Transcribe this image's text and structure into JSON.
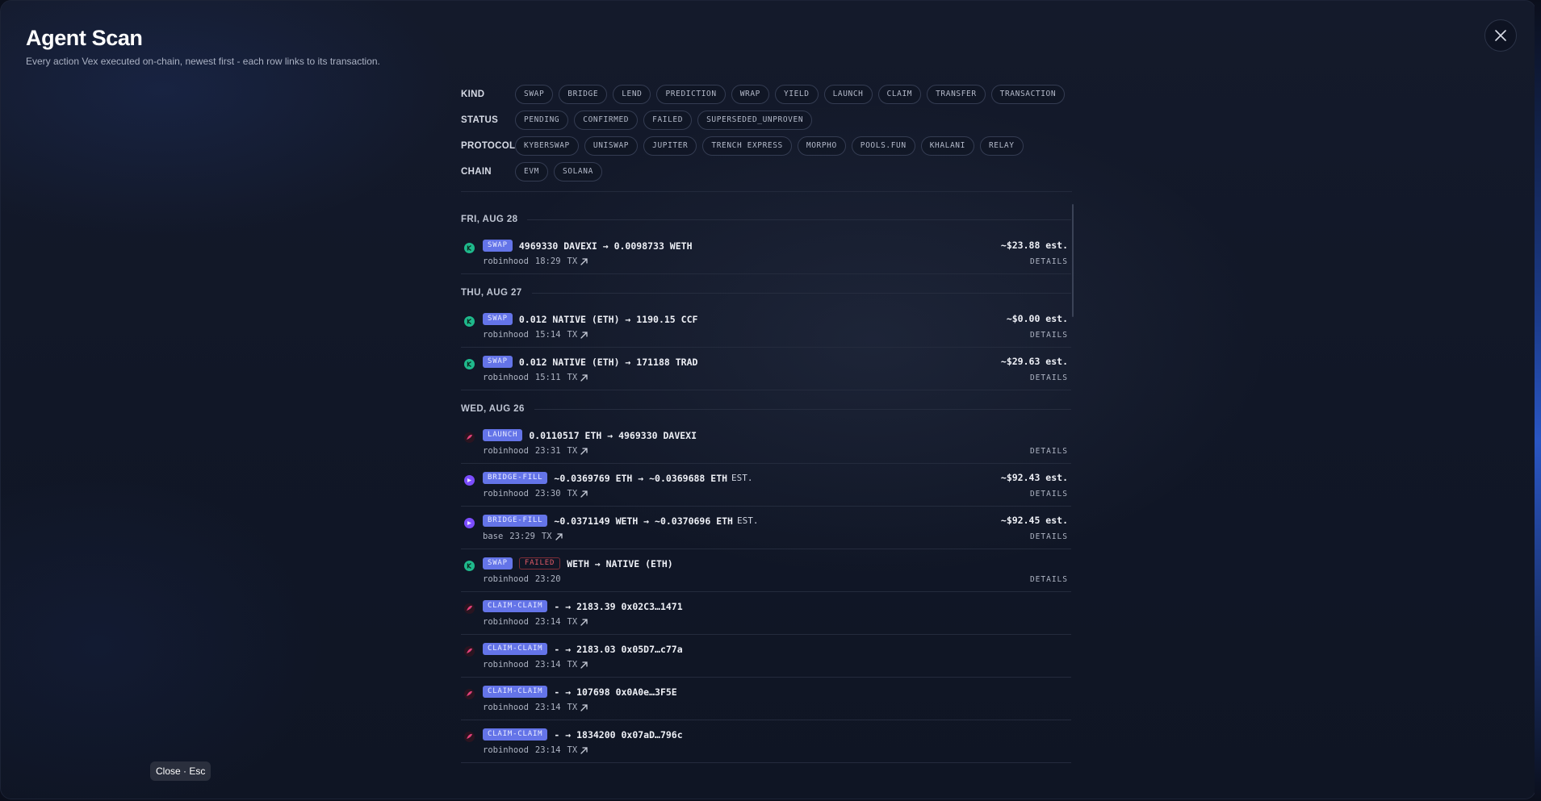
{
  "header": {
    "title": "Agent Scan",
    "subtitle": "Every action Vex executed on-chain, newest first - each row links to its transaction."
  },
  "close_hint": "Close · Esc",
  "filters": {
    "kind": {
      "label": "KIND",
      "chips": [
        "SWAP",
        "BRIDGE",
        "LEND",
        "PREDICTION",
        "WRAP",
        "YIELD",
        "LAUNCH",
        "CLAIM",
        "TRANSFER",
        "TRANSACTION"
      ]
    },
    "status": {
      "label": "STATUS",
      "chips": [
        "PENDING",
        "CONFIRMED",
        "FAILED",
        "SUPERSEDED_UNPROVEN"
      ]
    },
    "protocol": {
      "label": "PROTOCOL",
      "chips": [
        "KYBERSWAP",
        "UNISWAP",
        "JUPITER",
        "TRENCH EXPRESS",
        "MORPHO",
        "POOLS.FUN",
        "KHALANI",
        "RELAY"
      ]
    },
    "chain": {
      "label": "CHAIN",
      "chips": [
        "EVM",
        "SOLANA"
      ]
    }
  },
  "details_label": "DETAILS",
  "tx_label": "TX",
  "groups": [
    {
      "day": "FRI, AUG 28",
      "rows": [
        {
          "icon": "kyber",
          "badge": "SWAP",
          "text": "4969330 DAVEXI → 0.0098733 WETH",
          "est": "",
          "chain": "robinhood",
          "time": "18:29",
          "tx": true,
          "usd": "~$23.88 est."
        }
      ]
    },
    {
      "day": "THU, AUG 27",
      "rows": [
        {
          "icon": "kyber",
          "badge": "SWAP",
          "text": "0.012 NATIVE (ETH) → 1190.15 CCF",
          "est": "",
          "chain": "robinhood",
          "time": "15:14",
          "tx": true,
          "usd": "~$0.00 est."
        },
        {
          "icon": "kyber",
          "badge": "SWAP",
          "text": "0.012 NATIVE (ETH) → 171188 TRAD",
          "est": "",
          "chain": "robinhood",
          "time": "15:11",
          "tx": true,
          "usd": "~$29.63 est."
        }
      ]
    },
    {
      "day": "WED, AUG 26",
      "rows": [
        {
          "icon": "launch",
          "badge": "LAUNCH",
          "text": "0.0110517 ETH → 4969330 DAVEXI",
          "est": "",
          "chain": "robinhood",
          "time": "23:31",
          "tx": true,
          "usd": ""
        },
        {
          "icon": "relay",
          "badge": "BRIDGE-FILL",
          "text": "~0.0369769 ETH → ~0.0369688 ETH",
          "est": "EST.",
          "chain": "robinhood",
          "time": "23:30",
          "tx": true,
          "usd": "~$92.43 est."
        },
        {
          "icon": "relay",
          "badge": "BRIDGE-FILL",
          "text": "~0.0371149 WETH → ~0.0370696 ETH",
          "est": "EST.",
          "chain": "base",
          "time": "23:29",
          "tx": true,
          "usd": "~$92.45 est."
        },
        {
          "icon": "kyber",
          "badge": "SWAP",
          "failed": "FAILED",
          "text": "WETH → NATIVE (ETH)",
          "est": "",
          "chain": "robinhood",
          "time": "23:20",
          "tx": false,
          "usd": "",
          "details": true
        },
        {
          "icon": "launch",
          "badge": "CLAIM-CLAIM",
          "text": "- → 2183.39 0x02C3…1471",
          "est": "",
          "chain": "robinhood",
          "time": "23:14",
          "tx": true,
          "usd": "",
          "nodetails": true
        },
        {
          "icon": "launch",
          "badge": "CLAIM-CLAIM",
          "text": "- → 2183.03 0x05D7…c77a",
          "est": "",
          "chain": "robinhood",
          "time": "23:14",
          "tx": true,
          "usd": "",
          "nodetails": true
        },
        {
          "icon": "launch",
          "badge": "CLAIM-CLAIM",
          "text": "- → 107698 0x0A0e…3F5E",
          "est": "",
          "chain": "robinhood",
          "time": "23:14",
          "tx": true,
          "usd": "",
          "nodetails": true
        },
        {
          "icon": "launch",
          "badge": "CLAIM-CLAIM",
          "text": "- → 1834200 0x07aD…796c",
          "est": "",
          "chain": "robinhood",
          "time": "23:14",
          "tx": true,
          "usd": "",
          "nodetails": true
        }
      ]
    }
  ]
}
